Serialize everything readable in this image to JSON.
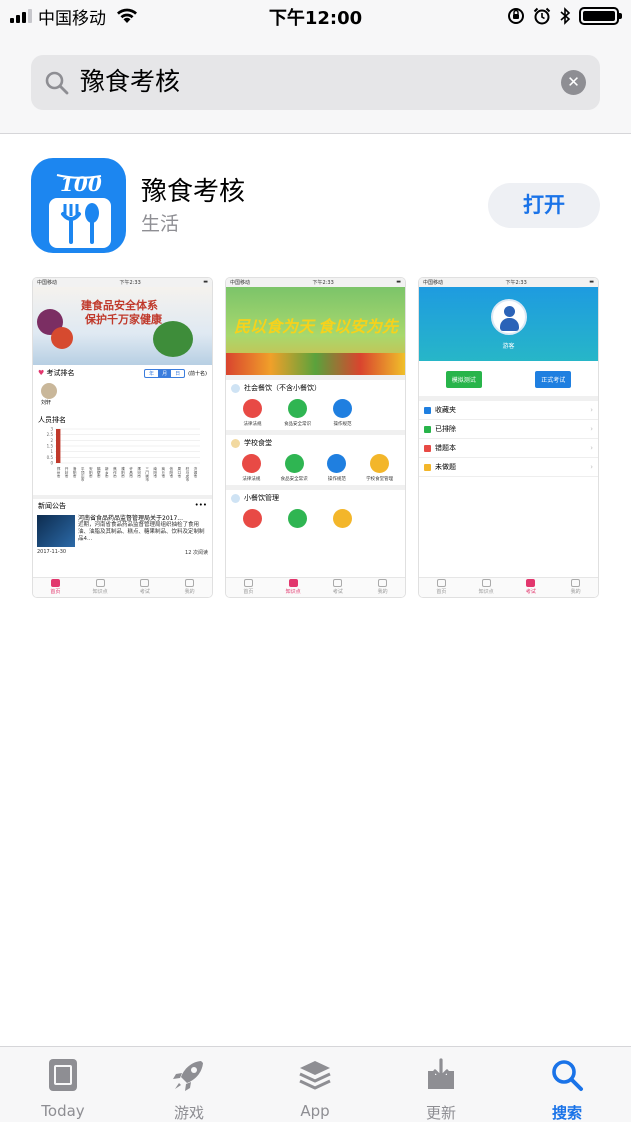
{
  "status_bar": {
    "carrier": "中国移动",
    "time": "下午12:00"
  },
  "search": {
    "query": "豫食考核"
  },
  "app": {
    "name": "豫食考核",
    "category": "生活",
    "open_label": "打开",
    "icon_text": "100"
  },
  "screenshots": {
    "common": {
      "carrier": "中国移动",
      "time": "下午2:33"
    },
    "s1": {
      "banner_line1": "建食品安全体系",
      "banner_line2": "保护千万家健康",
      "exam_rank": "考试排名",
      "segments": [
        "年",
        "月",
        "日"
      ],
      "top10": "(前十名)",
      "user_name": "刘轩",
      "staff_rank": "人员排名",
      "chart_data": {
        "type": "bar",
        "categories": [
          "郑州市",
          "开封市",
          "洛阳市",
          "平顶山市",
          "安阳市",
          "鹤壁市",
          "新乡市",
          "焦作市",
          "濮阳市",
          "许昌市",
          "漯河市",
          "三门峡市",
          "南阳市",
          "商丘市",
          "信阳市",
          "周口市",
          "驻马店市",
          "济源市"
        ],
        "values": [
          3,
          0,
          0,
          0,
          0,
          0,
          0,
          0,
          0,
          0,
          0,
          0,
          0,
          0,
          0,
          0,
          0,
          0
        ],
        "ylim": [
          0,
          3
        ],
        "yticks": [
          "3",
          "2.5",
          "2",
          "1.5",
          "1",
          "0.5",
          "0"
        ]
      },
      "news_header": "新闻公告",
      "news_more": "•••",
      "news_title": "河南省食品药品监督管理局关于2017...",
      "news_body": "近期，河南省食品药品监督管理局组织抽检了食用油、油脂及其制品、糕点、糖果制品、饮料及定制制品4...",
      "news_date": "2017-11-30",
      "news_reads": "12 次阅读",
      "tabs": [
        "首页",
        "知识点",
        "考试",
        "我的"
      ]
    },
    "s2": {
      "banner_a": "民以食为天",
      "banner_b": "食以安为先",
      "sec1": "社会餐饮（不含小餐饮）",
      "sec1_items": [
        "法律法规",
        "食品安全常识",
        "操作规范"
      ],
      "sec2": "学校食堂",
      "sec2_items": [
        "法律法规",
        "食品安全常识",
        "操作规范",
        "学校食堂管理"
      ],
      "sec3": "小餐饮管理",
      "tabs": [
        "首页",
        "知识点",
        "考试",
        "我的"
      ]
    },
    "s3": {
      "guest": "游客",
      "btn_mock": "模拟测试",
      "btn_formal": "正式考试",
      "items": [
        "收藏夹",
        "已排除",
        "错题本",
        "未做题"
      ],
      "tabs": [
        "首页",
        "知识点",
        "考试",
        "我的"
      ]
    }
  },
  "tab_bar": {
    "today": "Today",
    "games": "游戏",
    "apps": "App",
    "updates": "更新",
    "search": "搜索"
  },
  "colors": {
    "accent": "#1a73e8",
    "app_icon": "#1c86f0",
    "mini_tab_active": "#e2366d"
  }
}
